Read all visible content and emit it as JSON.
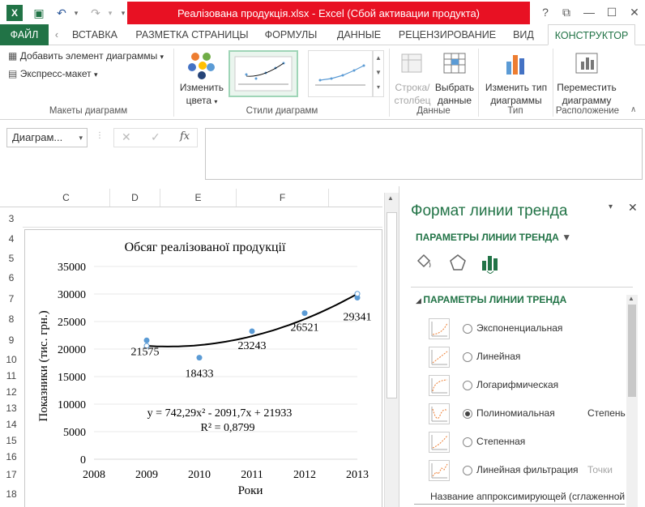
{
  "titlebar": {
    "title": "Реалізована продукція.xlsx -  Excel (Сбой активации продукта)",
    "help": "?",
    "restore": "⧉",
    "minimize": "—",
    "maximize": "☐",
    "close": "✕"
  },
  "tabs": {
    "file": "ФАЙЛ",
    "insert": "ВСТАВКА",
    "layout": "РАЗМЕТКА СТРАНИЦЫ",
    "formulas": "ФОРМУЛЫ",
    "data": "ДАННЫЕ",
    "review": "РЕЦЕНЗИРОВАНИЕ",
    "view": "ВИД",
    "design": "КОНСТРУКТОР"
  },
  "ribbon": {
    "add_element": "Добавить элемент диаграммы",
    "quick_layout": "Экспресс-макет",
    "group_layouts": "Макеты диаграмм",
    "change_colors_1": "Изменить",
    "change_colors_2": "цвета",
    "group_styles": "Стили диаграмм",
    "switch_row_1": "Строка/",
    "switch_row_2": "столбец",
    "select_data_1": "Выбрать",
    "select_data_2": "данные",
    "group_data": "Данные",
    "change_type_1": "Изменить тип",
    "change_type_2": "диаграммы",
    "group_type": "Тип",
    "move_chart_1": "Переместить",
    "move_chart_2": "диаграмму",
    "group_location": "Расположение"
  },
  "formula_bar": {
    "name_box": "Диаграм...",
    "fx": "fx"
  },
  "sheet": {
    "columns": [
      "C",
      "D",
      "E",
      "F"
    ],
    "rows": [
      "3",
      "4",
      "5",
      "6",
      "7",
      "8",
      "9",
      "10",
      "11",
      "12",
      "13",
      "14",
      "15",
      "16",
      "17",
      "18"
    ]
  },
  "chart_data": {
    "type": "scatter",
    "title": "Обсяг реалізованої продукції",
    "xlabel": "Роки",
    "ylabel": "Показники (тис. грн.)",
    "xlim": [
      2008,
      2013
    ],
    "ylim": [
      0,
      35000
    ],
    "x_ticks": [
      "2008",
      "2009",
      "2010",
      "2011",
      "2012",
      "2013"
    ],
    "y_ticks": [
      "0",
      "5000",
      "10000",
      "15000",
      "20000",
      "25000",
      "30000",
      "35000"
    ],
    "series": [
      {
        "points": [
          {
            "x": 2009,
            "y": 21575
          },
          {
            "x": 2010,
            "y": 18433
          },
          {
            "x": 2011,
            "y": 23243
          },
          {
            "x": 2012,
            "y": 26521
          },
          {
            "x": 2013,
            "y": 29341
          }
        ]
      }
    ],
    "data_labels": [
      "21575",
      "18433",
      "23243",
      "26521",
      "29341"
    ],
    "trendline": {
      "type": "polynomial",
      "coefficients": [
        742.29,
        -2091.7,
        21933
      ],
      "equation": "y = 742,29x² - 2091,7x + 21933",
      "r_squared": "R² = 0,8799"
    },
    "colors": {
      "points": "#5b9bd5",
      "trend": "#000000"
    }
  },
  "panel": {
    "title": "Формат линии тренда",
    "options_dropdown": "ПАРАМЕТРЫ ЛИНИИ ТРЕНДА",
    "section": "ПАРАМЕТРЫ ЛИНИИ ТРЕНДА",
    "options": [
      {
        "label": "Экспоненциальная",
        "selected": false
      },
      {
        "label": "Линейная",
        "selected": false
      },
      {
        "label": "Логарифмическая",
        "selected": false
      },
      {
        "label": "Полиномиальная",
        "selected": true,
        "extra": "Степень"
      },
      {
        "label": "Степенная",
        "selected": false
      },
      {
        "label": "Линейная фильтрация",
        "selected": false,
        "extra": "Точки"
      }
    ],
    "name_label": "Название аппроксимирующей (сглаженной"
  },
  "colors": {
    "accent": "#217346",
    "error_bar": "#e81123"
  }
}
